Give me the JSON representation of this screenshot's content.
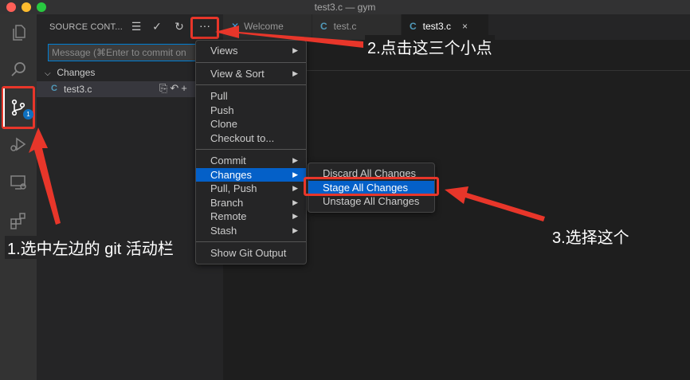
{
  "window": {
    "title": "test3.c — gym"
  },
  "activity_bar": {
    "git_badge": "1"
  },
  "sidebar": {
    "header": "SOURCE CONT...",
    "more_label": "···",
    "message_placeholder": "Message (⌘Enter to commit on ",
    "changes_label": "Changes",
    "file": {
      "icon_letter": "C",
      "name": "test3.c"
    }
  },
  "tabs": [
    {
      "label": "Welcome",
      "icon": "vscode-icon"
    },
    {
      "label": "test.c",
      "icon_letter": "C"
    },
    {
      "label": "test3.c",
      "icon_letter": "C",
      "close": "×"
    }
  ],
  "main_menu": {
    "views": "Views",
    "view_sort": "View & Sort",
    "pull": "Pull",
    "push": "Push",
    "clone": "Clone",
    "checkout": "Checkout to...",
    "commit": "Commit",
    "changes": "Changes",
    "pull_push": "Pull, Push",
    "branch": "Branch",
    "remote": "Remote",
    "stash": "Stash",
    "show_git_output": "Show Git Output"
  },
  "sub_menu": {
    "discard_all": "Discard All Changes",
    "stage_all": "Stage All Changes",
    "unstage_all": "Unstage All Changes"
  },
  "annotations": {
    "step1": "1.选中左边的 git 活动栏",
    "step2": "2.点击这三个小点",
    "step3": "3.选择这个"
  },
  "colors": {
    "highlight": "#0460c8",
    "annotation_red": "#e8362a"
  }
}
